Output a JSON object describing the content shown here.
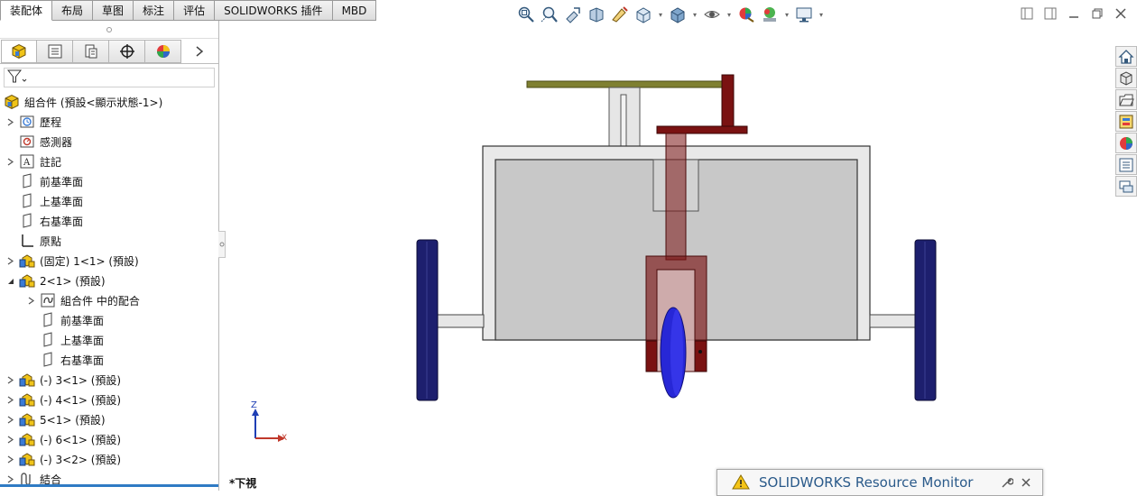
{
  "command_tabs": [
    {
      "label": "装配体"
    },
    {
      "label": "布局"
    },
    {
      "label": "草图"
    },
    {
      "label": "标注"
    },
    {
      "label": "评估"
    },
    {
      "label": "SOLIDWORKS 插件"
    },
    {
      "label": "MBD"
    }
  ],
  "hud_icons": [
    "zoom-to-fit-icon",
    "zoom-area-icon",
    "previous-view-icon",
    "section-view-icon",
    "dynamic-annotation-icon",
    "view-orientation-icon",
    "display-style-icon",
    "hide-show-items-icon",
    "edit-appearance-icon",
    "apply-scene-icon",
    "view-settings-icon"
  ],
  "panel_tabs": [
    "feature-manager-icon",
    "property-manager-icon",
    "configuration-manager-icon",
    "dimxpert-manager-icon",
    "display-manager-icon"
  ],
  "tree": {
    "root": "組合件  (預設<顯示狀態-1>)",
    "items": [
      {
        "label": "歷程",
        "icon": "history-icon",
        "expander": "closed",
        "level": 1
      },
      {
        "label": "感測器",
        "icon": "sensor-icon",
        "expander": "none",
        "level": 1
      },
      {
        "label": "註記",
        "icon": "annotations-icon",
        "expander": "closed",
        "level": 1
      },
      {
        "label": "前基準面",
        "icon": "plane-icon",
        "expander": "none",
        "level": 1
      },
      {
        "label": "上基準面",
        "icon": "plane-icon",
        "expander": "none",
        "level": 1
      },
      {
        "label": "右基準面",
        "icon": "plane-icon",
        "expander": "none",
        "level": 1
      },
      {
        "label": "原點",
        "icon": "origin-icon",
        "expander": "none",
        "level": 1
      },
      {
        "label": "(固定) 1<1> (預設)",
        "icon": "part-icon",
        "expander": "closed",
        "level": 1
      },
      {
        "label": "2<1> (預設)",
        "icon": "part-icon",
        "expander": "open",
        "level": 1
      },
      {
        "label": "組合件 中的配合",
        "icon": "mates-icon",
        "expander": "closed",
        "level": 2
      },
      {
        "label": "前基準面",
        "icon": "plane-icon",
        "expander": "none",
        "level": 2
      },
      {
        "label": "上基準面",
        "icon": "plane-icon",
        "expander": "none",
        "level": 2
      },
      {
        "label": "右基準面",
        "icon": "plane-icon",
        "expander": "none",
        "level": 2
      },
      {
        "label": "(-) 3<1> (預設)",
        "icon": "part-icon",
        "expander": "closed",
        "level": 1
      },
      {
        "label": "(-) 4<1> (預設)",
        "icon": "part-icon",
        "expander": "closed",
        "level": 1
      },
      {
        "label": "5<1> (預設)",
        "icon": "part-icon",
        "expander": "closed",
        "level": 1
      },
      {
        "label": "(-) 6<1> (預設)",
        "icon": "part-icon",
        "expander": "closed",
        "level": 1
      },
      {
        "label": "(-) 3<2> (預設)",
        "icon": "part-icon",
        "expander": "closed",
        "level": 1
      },
      {
        "label": "結合",
        "icon": "mates-group-icon",
        "expander": "closed",
        "level": 1
      }
    ]
  },
  "viewport": {
    "view_name": "*下視",
    "triad": {
      "z": "Z",
      "x": "X"
    }
  },
  "taskpane_icons": [
    "solidworks-resources-icon",
    "design-library-icon",
    "file-explorer-icon",
    "view-palette-icon",
    "appearances-scenes-icon",
    "custom-properties-icon",
    "solidworks-forum-icon"
  ],
  "resource_monitor": {
    "title": "SOLIDWORKS Resource Monitor"
  },
  "colors": {
    "active_tab": "#ffffff",
    "panel_accent": "#2f7bc4",
    "wheel_blue": "#1d1f6e",
    "arm_red": "#7a1212",
    "plate_olive": "#7f8031",
    "body_gray": "#c8c8c8"
  }
}
